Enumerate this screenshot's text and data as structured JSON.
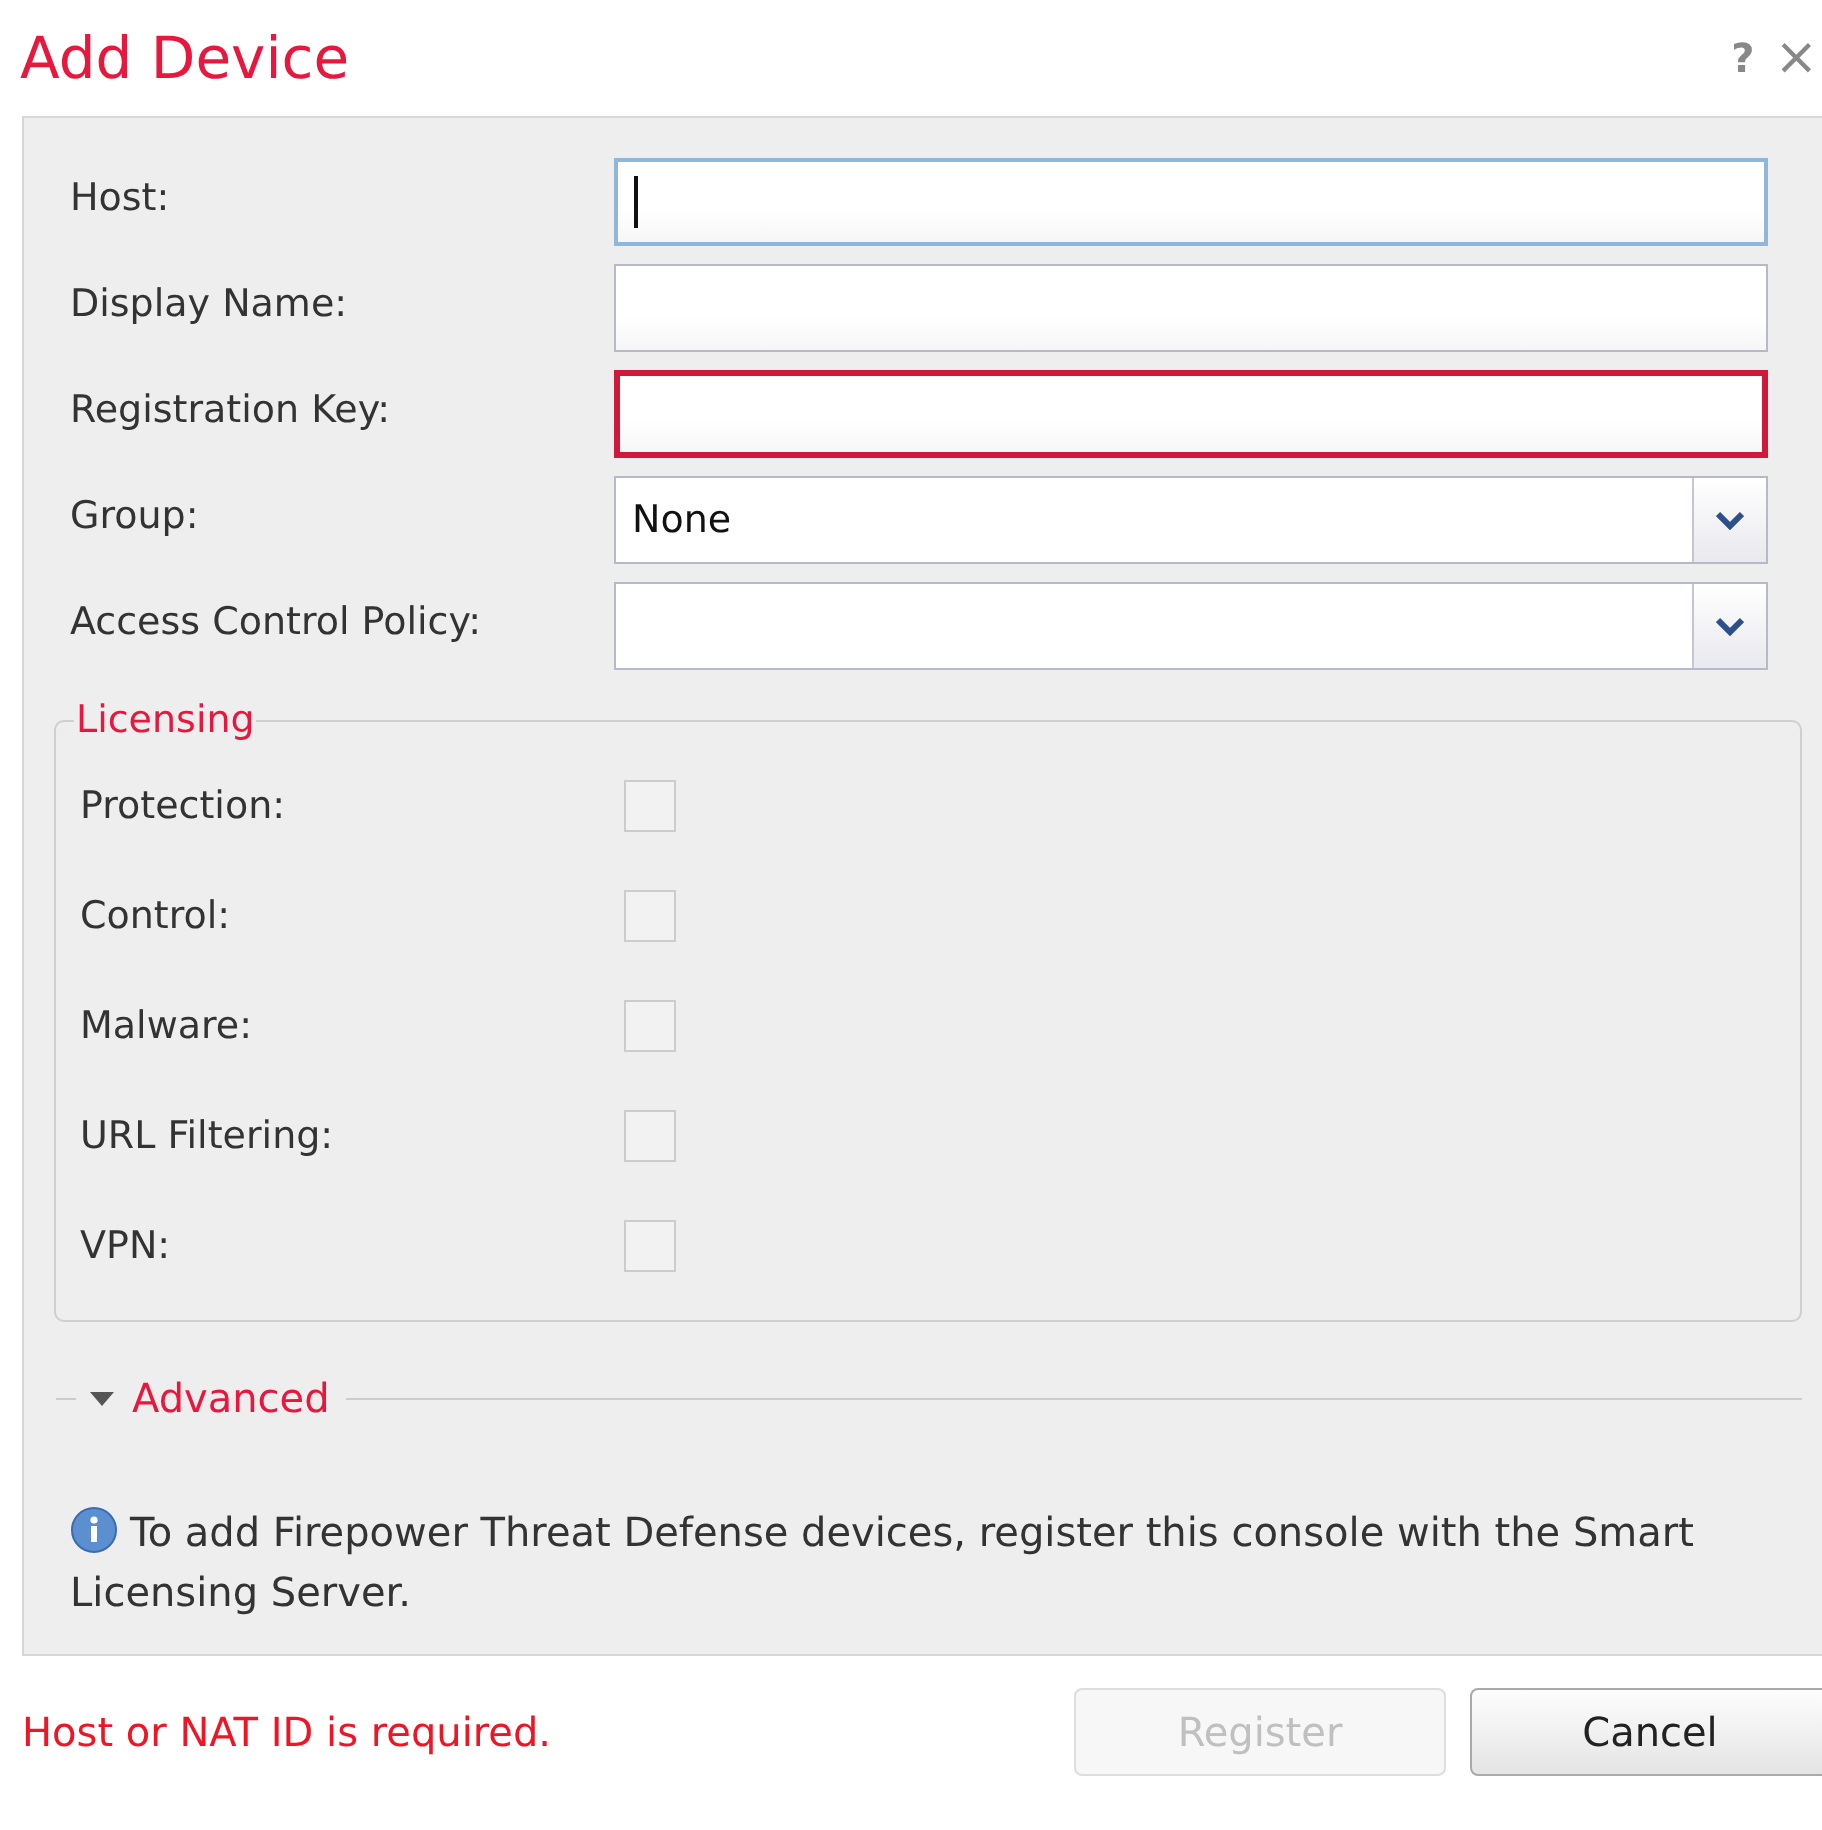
{
  "dialog": {
    "title": "Add Device",
    "help": "?",
    "close": "×"
  },
  "fields": [
    {
      "label": "Host:",
      "kind": "text",
      "focused": true,
      "invalid": false
    },
    {
      "label": "Display Name:",
      "kind": "text",
      "focused": false,
      "invalid": false
    },
    {
      "label": "Registration Key:",
      "kind": "text",
      "focused": false,
      "invalid": true
    },
    {
      "label": "Group:",
      "kind": "select",
      "value": "None",
      "focused": false,
      "invalid": false
    },
    {
      "label": "Access Control Policy:",
      "kind": "select",
      "focused": false,
      "invalid": false
    }
  ],
  "licensing": {
    "legend": "Licensing",
    "options": [
      {
        "label": "Protection:",
        "checked": false,
        "disabled": true
      },
      {
        "label": "Control:",
        "checked": false,
        "disabled": true
      },
      {
        "label": "Malware:",
        "checked": false,
        "disabled": true
      },
      {
        "label": "URL Filtering:",
        "checked": false,
        "disabled": true
      },
      {
        "label": "VPN:",
        "checked": false,
        "disabled": true
      }
    ]
  },
  "advanced": {
    "label": "Advanced",
    "expanded": true
  },
  "info": "To add Firepower Threat Defense devices, register this console with the Smart Licensing Server.",
  "footer": {
    "error": "Host or NAT ID is required.",
    "buttons": [
      {
        "label": "Register",
        "disabled": true
      },
      {
        "label": "Cancel",
        "disabled": false
      }
    ]
  }
}
